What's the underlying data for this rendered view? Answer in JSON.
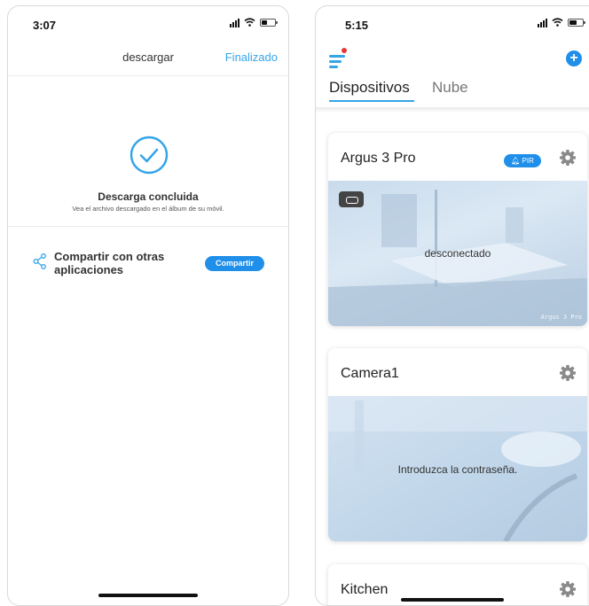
{
  "left": {
    "status_time": "3:07",
    "nav_title": "descargar",
    "done_label": "Finalizado",
    "download_title": "Descarga concluida",
    "download_subtitle": "Vea el archivo descargado en el álbum de su móvil.",
    "share_label": "Compartir con otras aplicaciones",
    "share_button": "Compartir"
  },
  "right": {
    "status_time": "5:15",
    "tabs": [
      "Dispositivos",
      "Nube"
    ],
    "devices": [
      {
        "name": "Argus 3 Pro",
        "badge": "PIR",
        "status": "desconectado",
        "watermark": "Argus 3 Pro"
      },
      {
        "name": "Camera1",
        "status": "Introduzca la contraseña."
      },
      {
        "name": "Kitchen"
      }
    ]
  },
  "colors": {
    "accent": "#35a5e8",
    "button_blue": "#1f8fea",
    "notification_red": "#e53935"
  },
  "icons": [
    "check-circle-icon",
    "share-icon",
    "menu-icon",
    "add-icon",
    "gear-icon",
    "battery-icon",
    "bell-icon",
    "wifi-icon",
    "signal-icon"
  ]
}
